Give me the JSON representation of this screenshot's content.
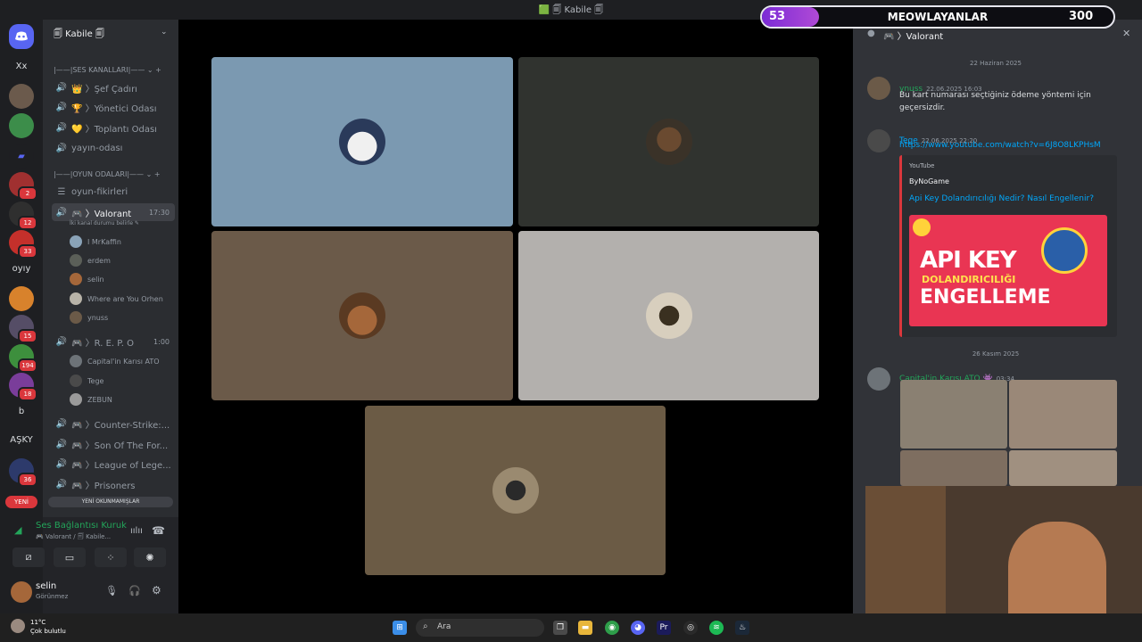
{
  "window": {
    "title": "🟩 🗐 Kabile 🗐"
  },
  "rail": {
    "items": [
      {
        "label": "Xx",
        "badge": ""
      },
      {
        "label": "",
        "badge": ""
      },
      {
        "label": "",
        "badge": ""
      },
      {
        "label": "",
        "badge": "2"
      },
      {
        "label": "",
        "badge": "12"
      },
      {
        "label": "",
        "badge": "33"
      },
      {
        "label": "oyıy",
        "badge": ""
      },
      {
        "label": "",
        "badge": ""
      },
      {
        "label": "",
        "badge": "15"
      },
      {
        "label": "",
        "badge": "194"
      },
      {
        "label": "",
        "badge": "18"
      },
      {
        "label": "b",
        "badge": ""
      },
      {
        "label": "AŞKY",
        "badge": ""
      },
      {
        "label": "",
        "badge": "36"
      }
    ],
    "new_label": "YENİ"
  },
  "sidebar": {
    "server_name": "🗐 Kabile 🗐",
    "categories": [
      {
        "label": "|——|SES KANALLARI|—— ⌄ +"
      },
      {
        "label": "|——|OYUN ODALARI|—— ⌄ +"
      }
    ],
    "channels": [
      {
        "label": "👑 〉Şef Çadırı"
      },
      {
        "label": "🏆 〉Yönetici Odası"
      },
      {
        "label": "💛 〉Toplantı Odası"
      },
      {
        "label": "yayın-odası"
      },
      {
        "label": "oyun-fikirleri"
      },
      {
        "label": "🎮 〉Valorant",
        "time": "17:30",
        "sub": "İki kanal durumu belirle ✎"
      },
      {
        "label": "🎮 〉R. E. P. O",
        "time": "1:00"
      },
      {
        "label": "🎮 〉Counter-Strike:..."
      },
      {
        "label": "🎮 〉Son Of The For..."
      },
      {
        "label": "🎮 〉League of Lege..."
      },
      {
        "label": "🎮 〉Prisoners"
      }
    ],
    "valorant_members": [
      "I MrKaffin",
      "erdem",
      "selin",
      "Where are You Orhen",
      "ynuss"
    ],
    "repo_members": [
      "Capital'in Karısı ATO",
      "Tege",
      "ZEBUN"
    ],
    "unread_label": "YENİ OKUNMAMIŞLAR",
    "voice_status": "Ses Bağlantısı Kuruk",
    "voice_sub": "🎮 Valorant / 🗐 Kabile...",
    "user_name": "selin",
    "user_status": "Görünmez"
  },
  "chat": {
    "channel_title": "🎮 〉Valorant",
    "dates": [
      "22 Haziran 2025",
      "26 Kasım 2025"
    ],
    "messages": [
      {
        "author": "ynuss",
        "time": "22.06.2025 16:03",
        "text": "Bu kart numarası seçtiğiniz ödeme yöntemi için geçersizdir."
      },
      {
        "author": "Tege",
        "time": "22.06.2025 22:20",
        "text": "https://www.youtube.com/watch?v=6J8O8LKPHsM"
      },
      {
        "author": "Capital'in Karısı ATO 👾",
        "time": "03:34",
        "text": ""
      }
    ],
    "embed": {
      "provider": "YouTube",
      "author": "ByNoGame",
      "title": "Api Key Dolandırıcılığı Nedir? Nasıl Engellenir?",
      "thumb_line1": "API KEY",
      "thumb_line2": "DOLANDIRICILIĞI",
      "thumb_line3": "ENGELLEME"
    }
  },
  "overlay": {
    "left_value": "53",
    "name": "MEOWLAYANLAR",
    "right_value": "300"
  },
  "taskbar": {
    "weather_temp": "11°C",
    "weather_text": "Çok bulutlu",
    "search_placeholder": "Ara"
  },
  "colors": {
    "green": "#23a55a",
    "link": "#00a8fc",
    "accent": "#5865f2",
    "overlay_purple": "#a53bd6"
  }
}
